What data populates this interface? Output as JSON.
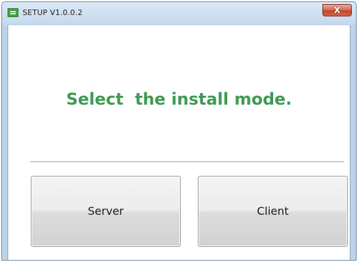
{
  "window": {
    "title": "SETUP V1.0.0.2",
    "close_label": "X"
  },
  "main": {
    "headline": "Select  the install mode.",
    "buttons": {
      "server_label": "Server",
      "client_label": "Client"
    }
  },
  "colors": {
    "headline_green": "#3e9b52",
    "close_red": "#c2442a",
    "titlebar_blue": "#c8dbee"
  },
  "icons": {
    "app": "setup-app-icon",
    "close": "close-icon"
  }
}
